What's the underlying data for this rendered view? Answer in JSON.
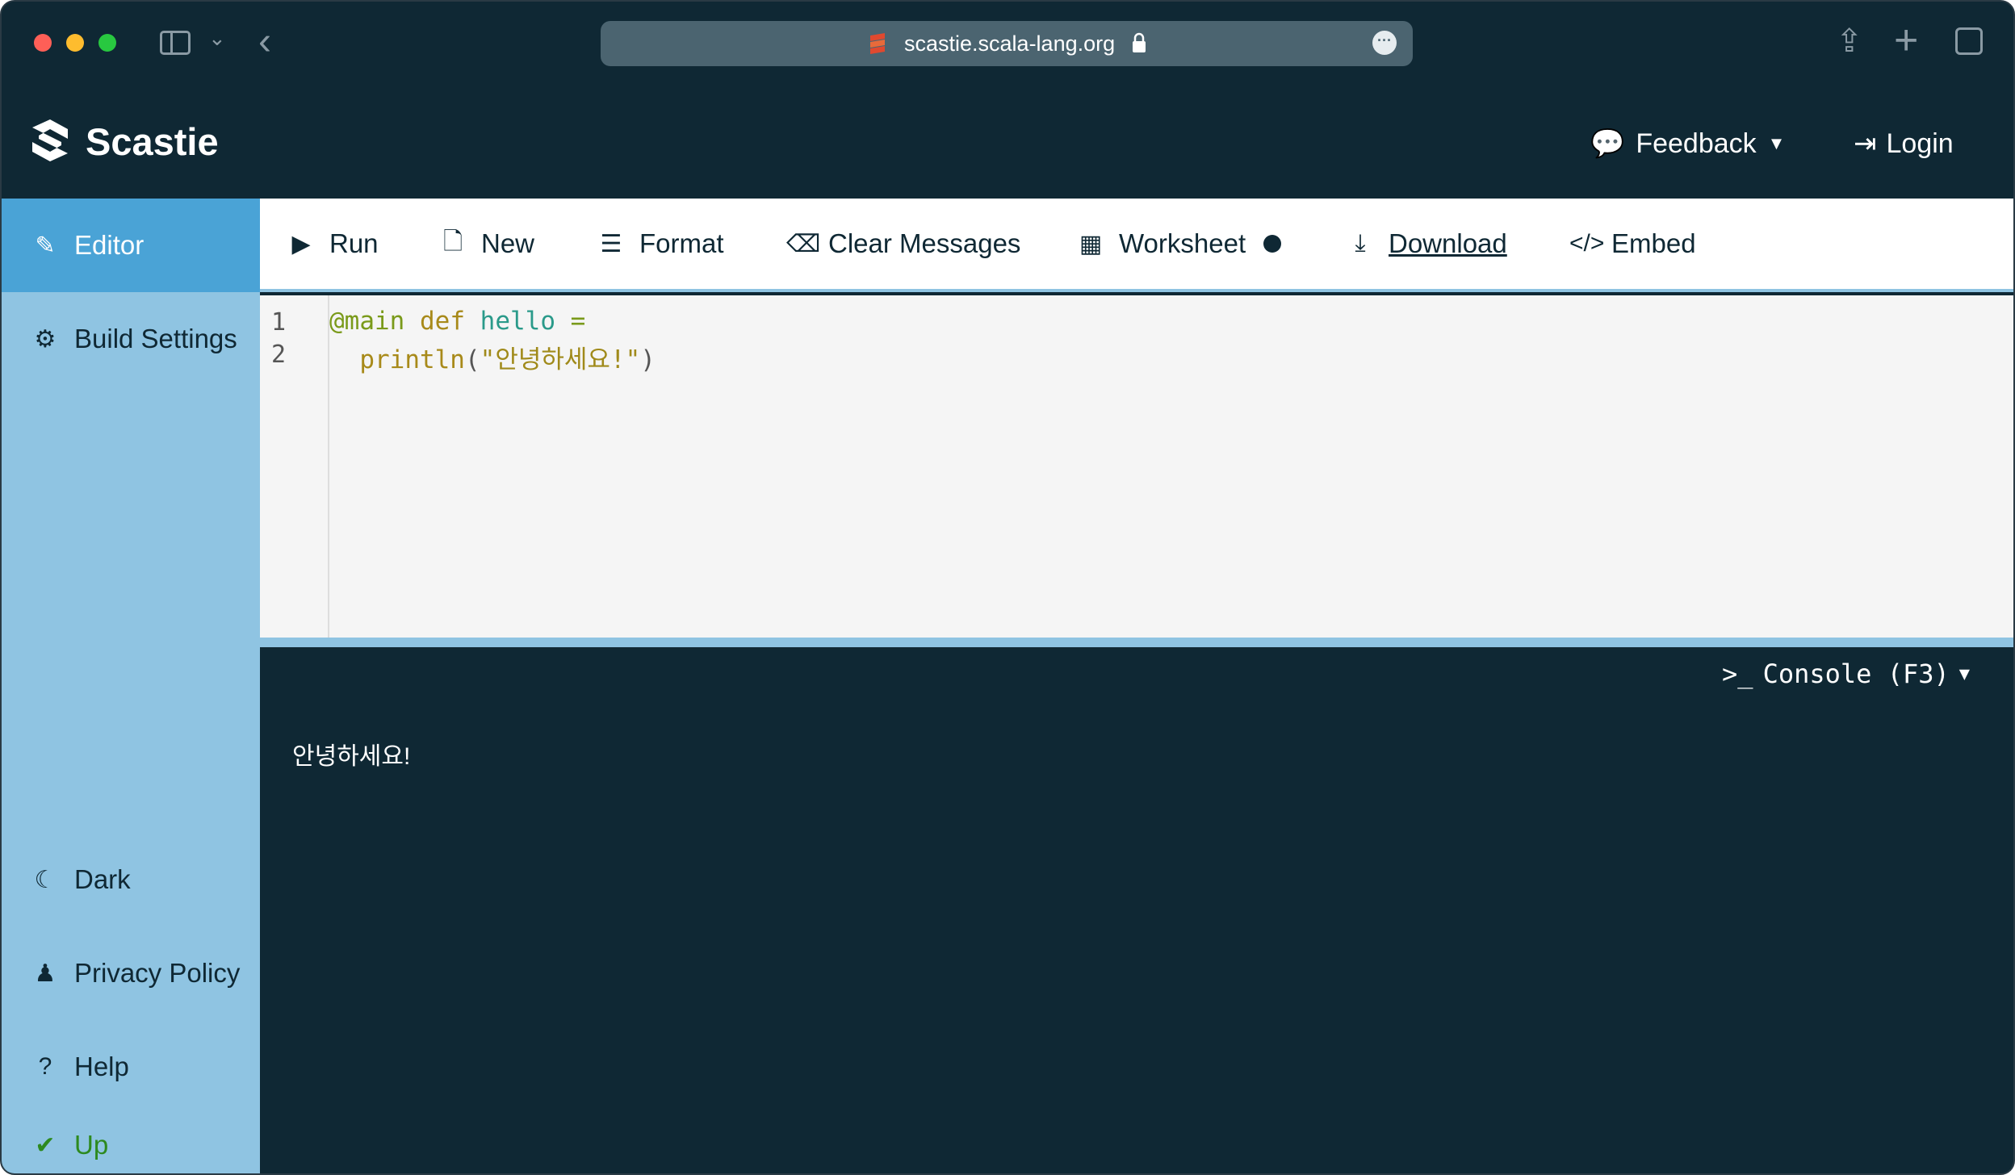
{
  "browser": {
    "url": "scastie.scala-lang.org"
  },
  "header": {
    "brand": "Scastie",
    "feedback_label": "Feedback",
    "login_label": "Login"
  },
  "sidenav": {
    "items": [
      {
        "label": "Editor",
        "icon": "edit-icon",
        "active": true
      },
      {
        "label": "Build Settings",
        "icon": "gear-icon"
      },
      {
        "label": "Dark",
        "icon": "moon-icon"
      },
      {
        "label": "Privacy Policy",
        "icon": "user-secret-icon"
      },
      {
        "label": "Help",
        "icon": "question-circle-icon"
      },
      {
        "label": "Up",
        "icon": "check-circle-icon"
      }
    ]
  },
  "toolbar": {
    "run": "Run",
    "new": "New",
    "format": "Format",
    "clear": "Clear Messages",
    "worksheet": "Worksheet",
    "download": "Download",
    "embed": "Embed"
  },
  "editor": {
    "line_numbers": [
      "1",
      "2"
    ],
    "line1": {
      "ann": "@main",
      "kw": "def",
      "name": "hello",
      "op": "="
    },
    "line2": {
      "indent": "  ",
      "call": "println",
      "open": "(",
      "str": "\"안녕하세요!\"",
      "close": ")"
    }
  },
  "console": {
    "toggle_label": "Console (F3)",
    "output": "안녕하세요!"
  },
  "colors": {
    "dark_bg": "#0f2834",
    "sidebar_bg": "#8fc4e2",
    "active_nav": "#4aa3d6",
    "status_ok": "#2d8a1f"
  }
}
